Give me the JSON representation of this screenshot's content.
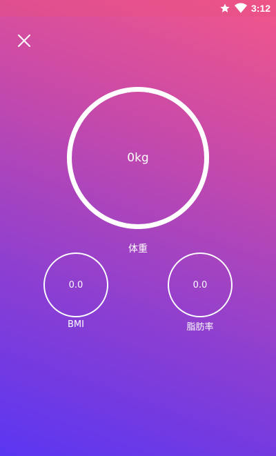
{
  "status_bar": {
    "time": "3:12",
    "icons": [
      "star-icon",
      "wifi-icon"
    ]
  },
  "header": {
    "close_icon": "close-icon"
  },
  "weight": {
    "value": "0kg",
    "label": "体重"
  },
  "bmi": {
    "value": "0.0",
    "label": "BMI"
  },
  "body_fat": {
    "value": "0.0",
    "label": "脂肪率"
  },
  "colors": {
    "gradient_top": "#f2578a",
    "gradient_bottom": "#5a36f2",
    "ring": "#ffffff"
  }
}
